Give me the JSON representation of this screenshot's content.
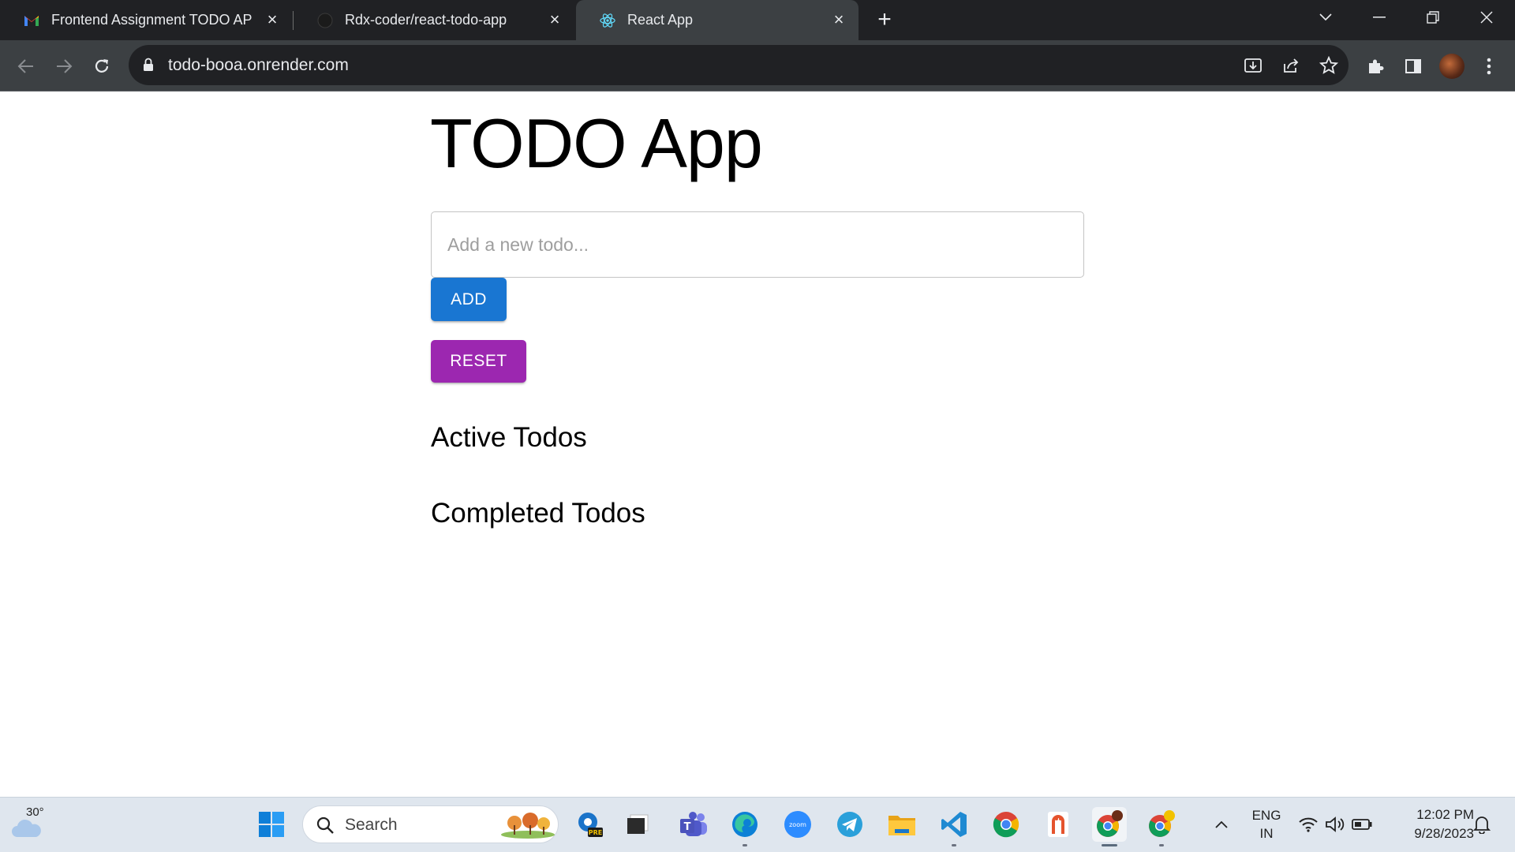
{
  "browser": {
    "tabs": [
      {
        "title": "Frontend Assignment TODO APP",
        "favicon": "gmail-icon",
        "active": false
      },
      {
        "title": "Rdx-coder/react-todo-app",
        "favicon": "github-icon",
        "active": false
      },
      {
        "title": "React App",
        "favicon": "react-icon",
        "active": true
      }
    ],
    "url": "todo-booa.onrender.com"
  },
  "app": {
    "title": "TODO App",
    "input_placeholder": "Add a new todo...",
    "add_label": "ADD",
    "reset_label": "RESET",
    "active_heading": "Active Todos",
    "completed_heading": "Completed Todos",
    "colors": {
      "add": "#1976d2",
      "reset": "#9c27b0"
    }
  },
  "taskbar": {
    "weather_temp": "30°",
    "search_label": "Search",
    "lang_line1": "ENG",
    "lang_line2": "IN",
    "time": "12:02 PM",
    "date": "9/28/2023",
    "apps": [
      "start-icon",
      "search-icon",
      "outlook-pre-icon",
      "task-view-icon",
      "teams-icon",
      "edge-icon",
      "zoom-icon",
      "telegram-icon",
      "file-explorer-icon",
      "vscode-icon",
      "chrome-icon",
      "app-icon",
      "chrome-profile-icon",
      "chrome-profile-2-icon"
    ]
  }
}
